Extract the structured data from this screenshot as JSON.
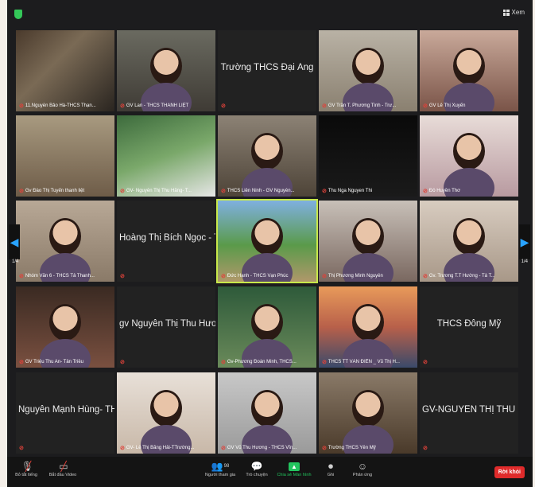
{
  "top": {
    "view_label": "Xem"
  },
  "tiles": [
    {
      "name": "11.Nguyễn Bảo Hà-THCS Thạn...",
      "big": ""
    },
    {
      "name": "GV Lan - THCS THANH LIỆT",
      "big": ""
    },
    {
      "name": "",
      "big": "Trường THCS Đại Áng"
    },
    {
      "name": "GV Trần T. Phương Tình - Trư...",
      "big": ""
    },
    {
      "name": "GV Lê Thị Xuyến",
      "big": ""
    },
    {
      "name": "Gv Đào Thị Tuyến thanh liệt",
      "big": ""
    },
    {
      "name": "GV- Nguyễn Thị Thu Hằng- T...",
      "big": ""
    },
    {
      "name": "THCS Liên Ninh - GV Nguyễn...",
      "big": ""
    },
    {
      "name": "Thu Nga Nguyen Thi",
      "big": ""
    },
    {
      "name": "Đỗ Huyền Thơ",
      "big": ""
    },
    {
      "name": "Nhóm Văn 6 - THCS Tả Thanh...",
      "big": ""
    },
    {
      "name": "",
      "big": "Hoàng Thị Bích Ngọc - TH..."
    },
    {
      "name": "Đức Hạnh - THCS Vạn Phúc",
      "big": ""
    },
    {
      "name": "Thị Phương Minh Nguyễn",
      "big": ""
    },
    {
      "name": "Gv. Trương T.T Hường - Tả T...",
      "big": ""
    },
    {
      "name": "GV Triệu Thu An- Tân Triều",
      "big": ""
    },
    {
      "name": "",
      "big": "gv Nguyễn Thị Thu Hương-..."
    },
    {
      "name": "Gv-Phương Đoàn Minh, THCS...",
      "big": ""
    },
    {
      "name": "THCS TT VĂN ĐIỂN _ Vũ Thị H...",
      "big": ""
    },
    {
      "name": "",
      "big": "THCS Đông Mỹ"
    },
    {
      "name": "",
      "big": "Nguyễn Mạnh Hùng- THCS..."
    },
    {
      "name": "GV- Lê Thị Băng Hải-TTrường...",
      "big": ""
    },
    {
      "name": "GV Vũ Thu Hương - THCS  Vĩn...",
      "big": ""
    },
    {
      "name": "Trường THCS Yên Mỹ",
      "big": ""
    },
    {
      "name": "",
      "big": "GV-NGUYỄN THỊ THU HU..."
    }
  ],
  "paging": {
    "left": "1/4",
    "right": "1/4"
  },
  "controls": {
    "mute": "Bỏ tắt tiếng",
    "video": "Bắt đầu Video",
    "participants": "Người tham gia",
    "participants_count": "98",
    "chat": "Trò chuyện",
    "share": "Chia sẻ Màn hình",
    "record": "Ghi",
    "reactions": "Phản ứng",
    "leave": "Rời khỏi"
  },
  "colors": {
    "share_green": "#22c55e",
    "leave_red": "#e02b2b",
    "active_border": "#c8e84a"
  }
}
